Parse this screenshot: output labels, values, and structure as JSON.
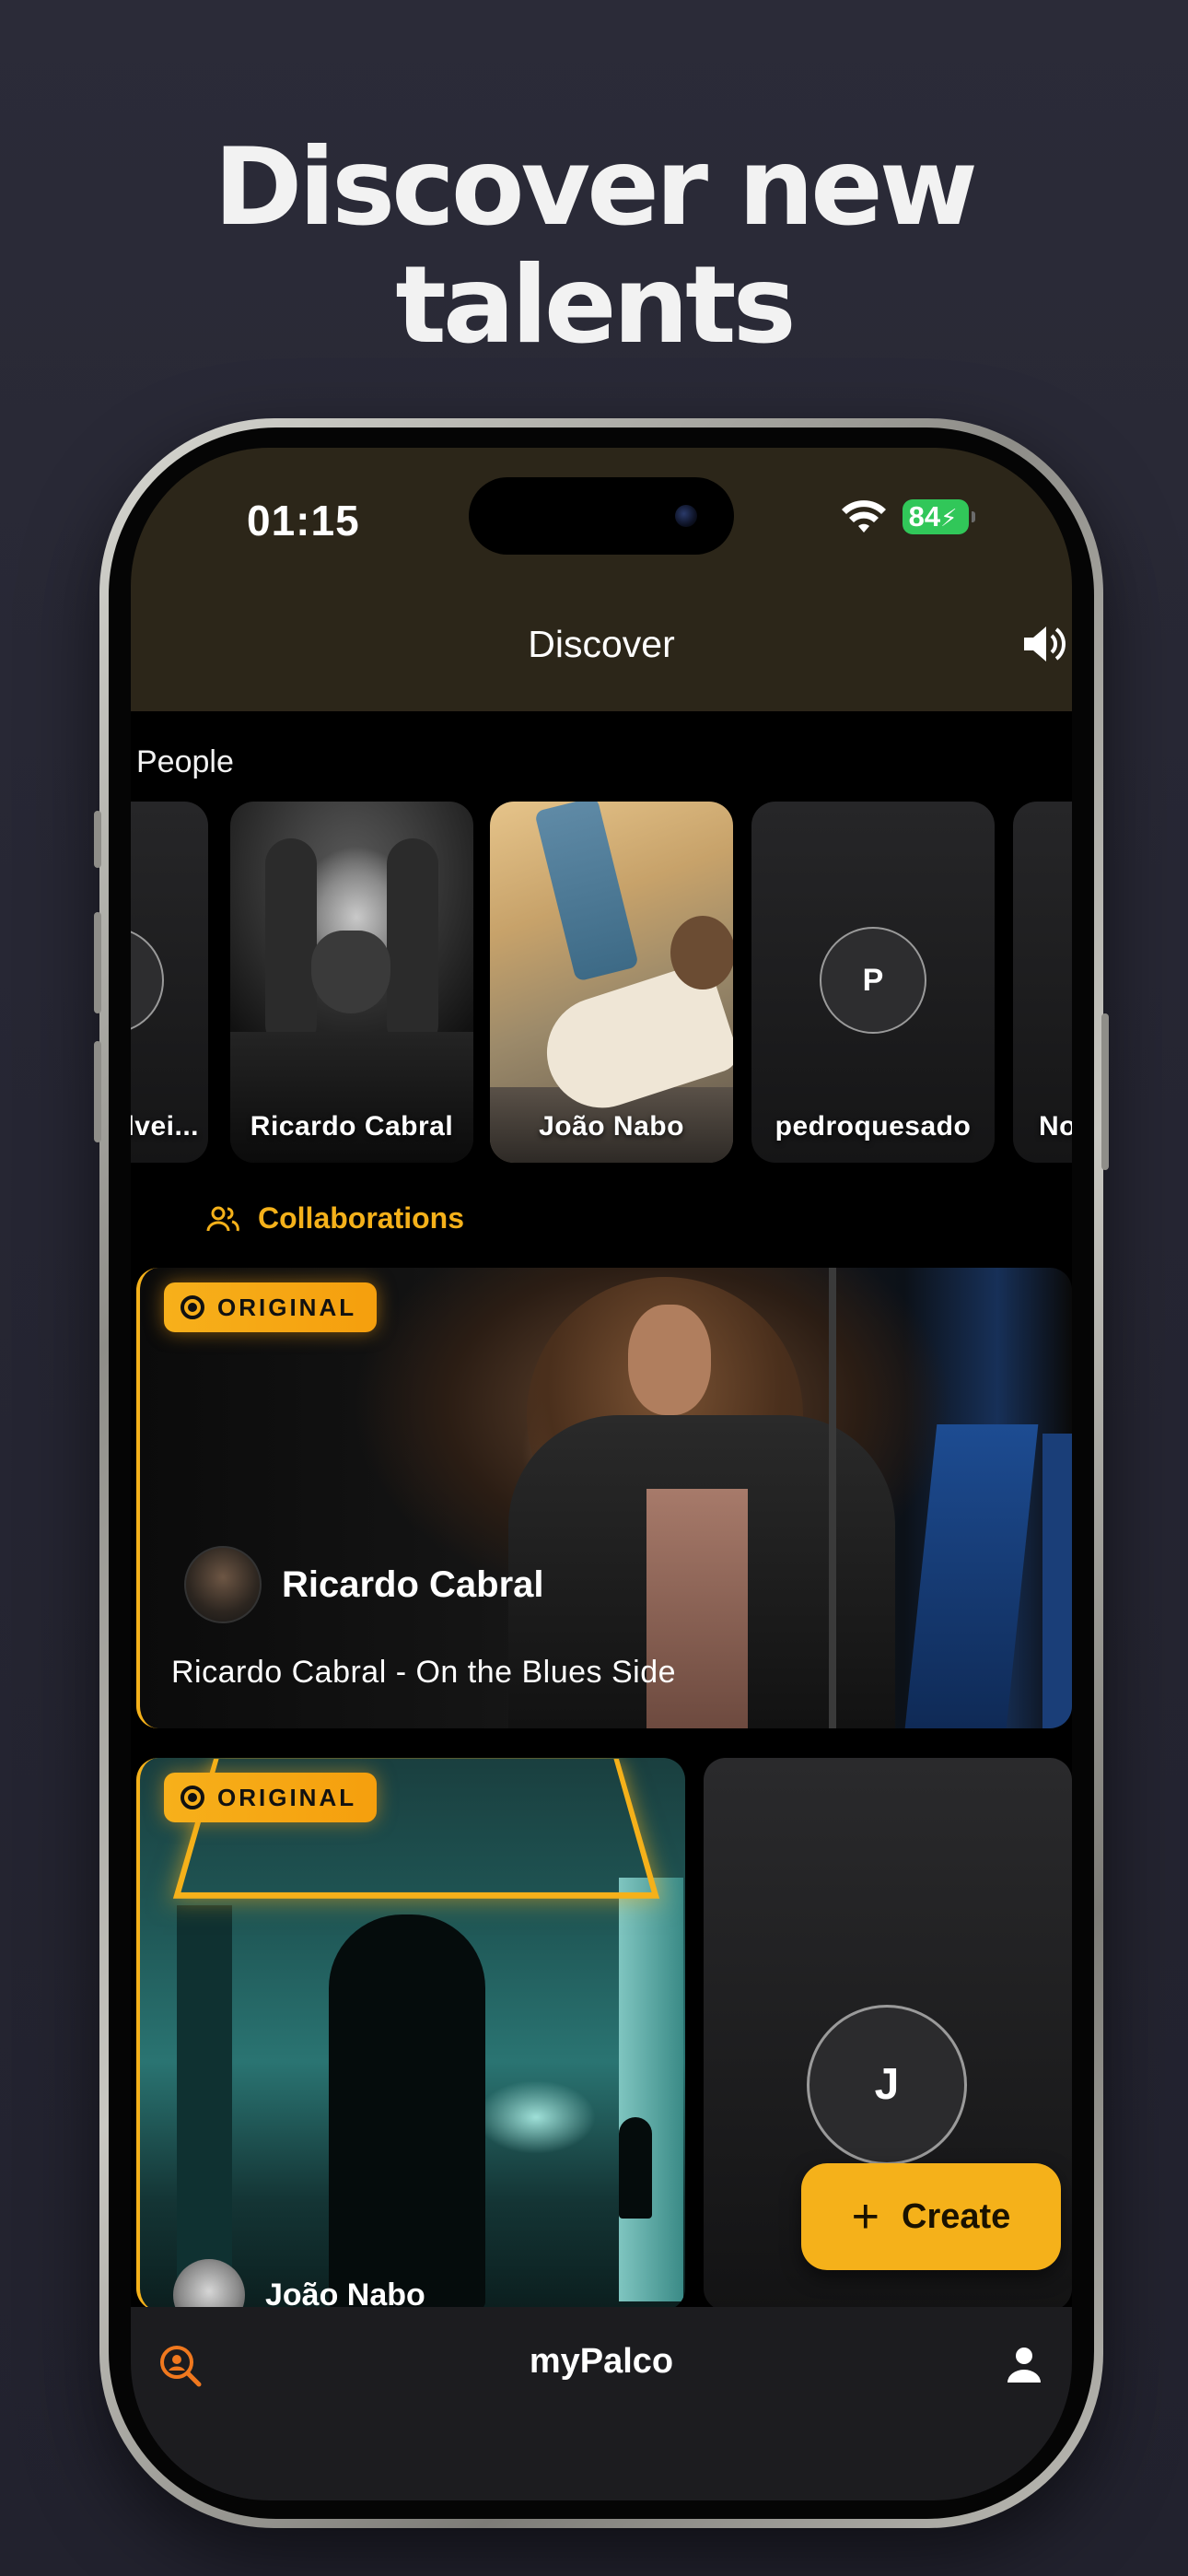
{
  "headline": {
    "line1": "Discover new",
    "line2": "talents"
  },
  "status_bar": {
    "time": "01:15",
    "battery": "84"
  },
  "nav": {
    "title": "Discover",
    "sound_icon": "speaker-icon"
  },
  "people": {
    "label": "People",
    "items": [
      {
        "name": "lvei...",
        "type": "initial"
      },
      {
        "name": "Ricardo Cabral",
        "type": "photo"
      },
      {
        "name": "João Nabo",
        "type": "photo"
      },
      {
        "name": "pedroquesado",
        "type": "initial",
        "initial": "P"
      },
      {
        "name": "No",
        "type": "placeholder"
      }
    ]
  },
  "collaborations": {
    "label": "Collaborations",
    "featured": {
      "badge": "ORIGINAL",
      "author": "Ricardo Cabral",
      "title": "Ricardo Cabral - On the Blues Side"
    },
    "left_card": {
      "badge": "ORIGINAL",
      "author": "João Nabo"
    },
    "right_card": {
      "initial": "J"
    }
  },
  "create_button": {
    "label": "Create"
  },
  "tabbar": {
    "title": "myPalco"
  },
  "colors": {
    "accent": "#f5b11a",
    "header": "#2c2619",
    "battery": "#31c759"
  }
}
